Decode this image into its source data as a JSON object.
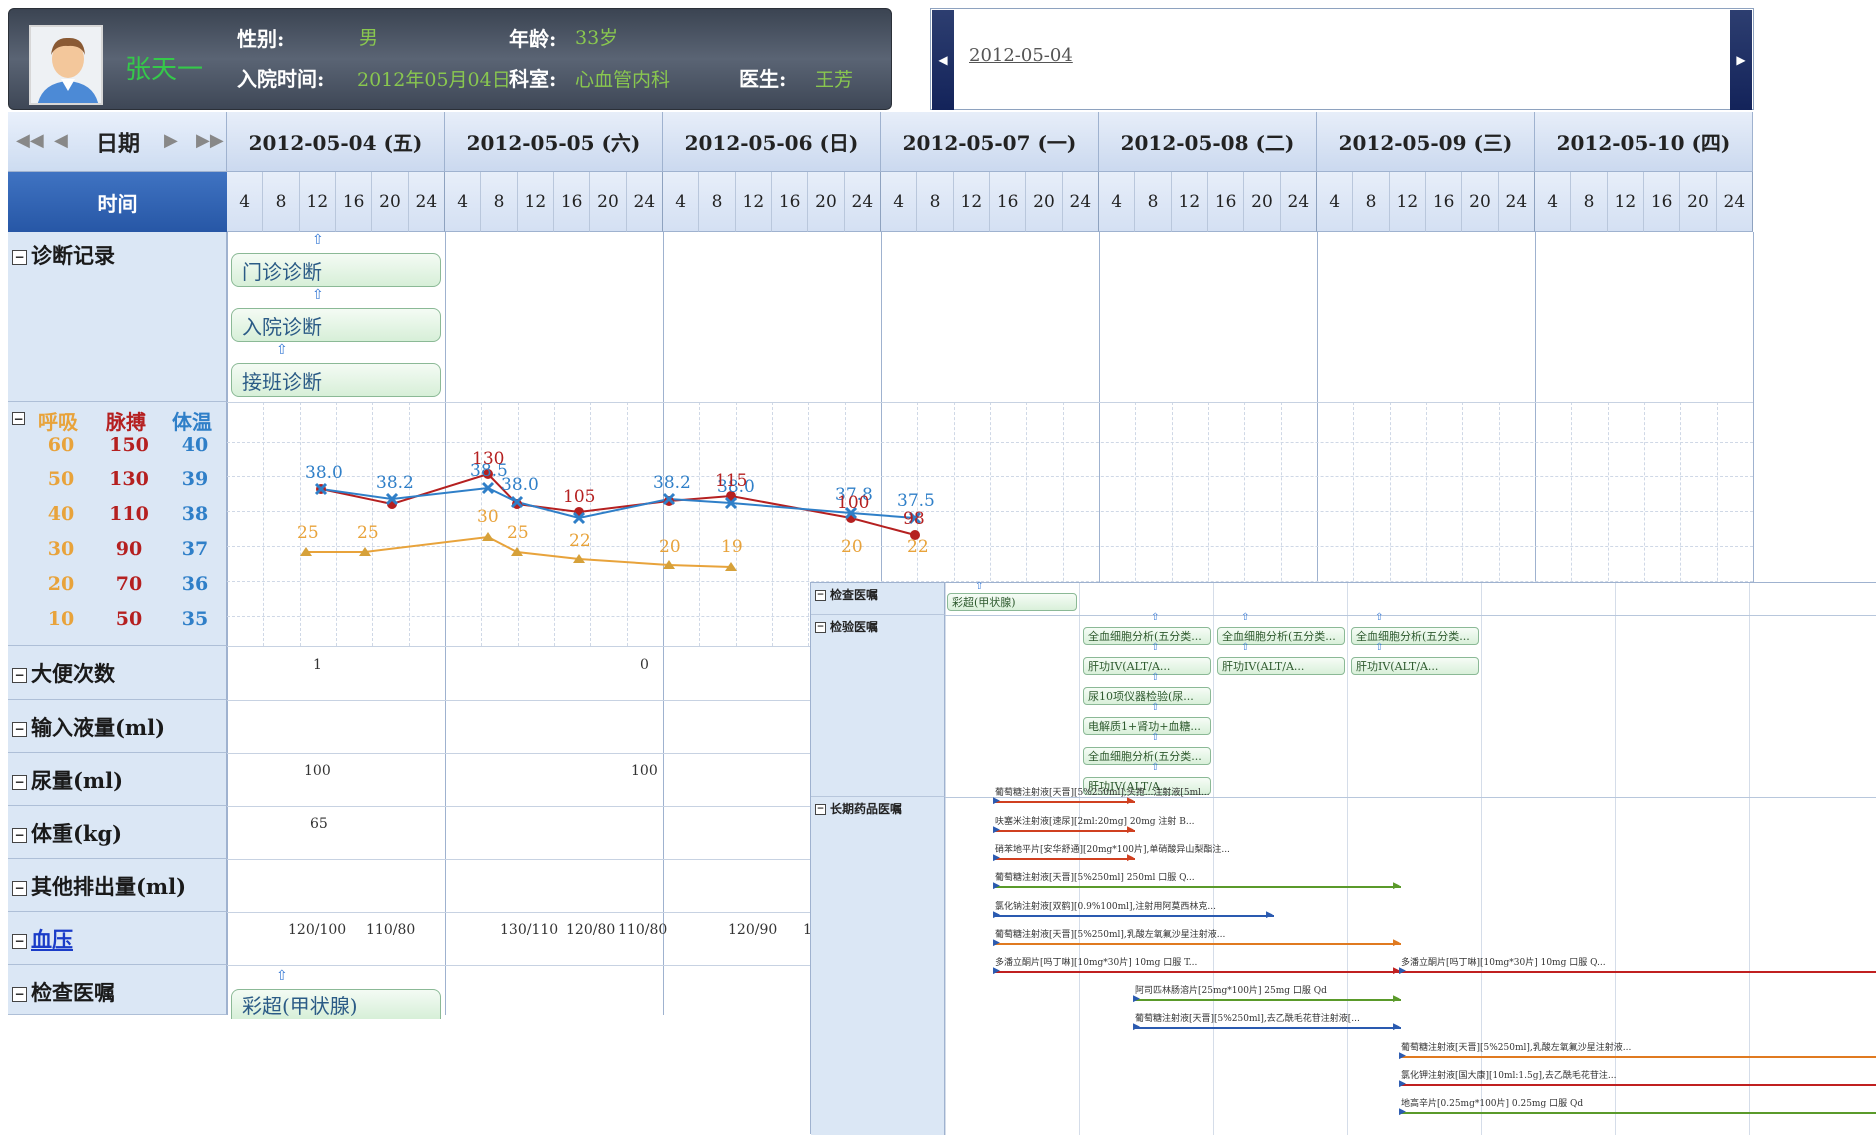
{
  "patient": {
    "name": "张天一",
    "gender_label": "性别:",
    "gender": "男",
    "age_label": "年龄:",
    "age": "33岁",
    "admit_label": "入院时间:",
    "admit_date": "2012年05月04日",
    "dept_label": "科室:",
    "dept": "心血管内科",
    "doctor_label": "医生:",
    "doctor": "王芳"
  },
  "date_nav": {
    "current_date": "2012-05-04",
    "prev_icon": "triangle-left-icon",
    "next_icon": "triangle-right-icon"
  },
  "grid_header": {
    "nav_first_icon": "double-left-arrow-icon",
    "nav_prev_icon": "left-arrow-icon",
    "nav_label": "日期",
    "nav_next_icon": "right-arrow-icon",
    "nav_last_icon": "double-right-arrow-icon",
    "time_label": "时间",
    "dates": [
      "2012-05-04 (五)",
      "2012-05-05 (六)",
      "2012-05-06 (日)",
      "2012-05-07 (一)",
      "2012-05-08 (二)",
      "2012-05-09 (三)",
      "2012-05-10 (四)"
    ],
    "hours": [
      "4",
      "8",
      "12",
      "16",
      "20",
      "24"
    ]
  },
  "rows": {
    "diagnosis_label": "诊断记录",
    "diagnosis_items": [
      "门诊诊断",
      "入院诊断",
      "接班诊断"
    ],
    "vitals_headers": {
      "resp": "呼吸",
      "pulse": "脉搏",
      "temp": "体温"
    },
    "resp_scale": [
      "60",
      "50",
      "40",
      "30",
      "20",
      "10"
    ],
    "pulse_scale": [
      "150",
      "130",
      "110",
      "90",
      "70",
      "50"
    ],
    "temp_scale": [
      "40",
      "39",
      "38",
      "37",
      "36",
      "35"
    ],
    "stool_label": "大便次数",
    "stool_values": [
      "1",
      "0"
    ],
    "input_label": "输入液量(ml)",
    "urine_label": "尿量(ml)",
    "urine_values": [
      "100",
      "100"
    ],
    "weight_label": "体重(kg)",
    "weight_values": [
      "65"
    ],
    "other_output_label": "其他排出量(ml)",
    "bp_label": "血压",
    "bp_values": [
      "120/100",
      "110/80",
      "130/110",
      "120/80",
      "110/80",
      "120/90",
      "1"
    ],
    "exam_label": "检查医嘱",
    "exam_items": [
      "彩超(甲状腺)"
    ]
  },
  "vitals": {
    "colors": {
      "resp": "#e8a33b",
      "pulse": "#b52020",
      "temp": "#2f7fc8"
    },
    "temp_labels": [
      "38.0",
      "38.2",
      "38.5",
      "38.0",
      "38.2",
      "38.0",
      "37.8",
      "37.5"
    ],
    "pulse_labels": [
      "130",
      "105",
      "115",
      "100",
      "98"
    ],
    "resp_labels": [
      "25",
      "25",
      "30",
      "25",
      "22",
      "20",
      "19",
      "20",
      "22"
    ]
  },
  "overlay": {
    "exam_label": "检查医嘱",
    "exam_items": [
      "彩超(甲状腺)"
    ],
    "lab_label": "检验医嘱",
    "lab_col1": [
      "全血细胞分析(五分类...",
      "肝功IV(ALT/A...",
      "尿10项仪器检验(尿...",
      "电解质1+肾功+血糖...",
      "全血细胞分析(五分类...",
      "肝功IV(ALT/A..."
    ],
    "lab_col2": [
      "全血细胞分析(五分类...",
      "肝功IV(ALT/A..."
    ],
    "lab_col3": [
      "全血细胞分析(五分类...",
      "肝功IV(ALT/A..."
    ],
    "longterm_label": "长期药品医嘱",
    "meds": [
      "葡萄糖注射液[天晋][5%250ml],头孢...注射液[5ml...",
      "呋塞米注射液[速尿][2ml:20mg] 20mg 注射 B...",
      "硝苯地平片[安华舒通][20mg*100片],单硝酸异山梨酯注...",
      "葡萄糖注射液[天晋][5%250ml] 250ml 口服 Q...",
      "氯化钠注射液[双鹤][0.9%100ml],注射用阿莫西林克...",
      "葡萄糖注射液[天晋][5%250ml],乳酸左氧氟沙星注射液...",
      "多潘立酮片[吗丁啉][10mg*30片] 10mg 口服 T...",
      "多潘立酮片[吗丁啉][10mg*30片] 10mg 口服 Q...",
      "阿司匹林肠溶片[25mg*100片] 25mg 口服 Qd",
      "葡萄糖注射液[天晋][5%250ml],去乙酰毛花苷注射液[...",
      "葡萄糖注射液[天晋][5%250ml],乳酸左氧氟沙星注射液...",
      "氯化钾注射液[国大康][10ml:1.5g],去乙酰毛花苷注...",
      "地高辛片[0.25mg*100片] 0.25mg 口服 Qd"
    ],
    "med_colors": [
      "#d04020",
      "#d04020",
      "#d04020",
      "#5a9a2a",
      "#2a5ab0",
      "#e07a20",
      "#c02020",
      "#c02020",
      "#5a9a2a",
      "#2a5ab0",
      "#e07a20",
      "#c02020",
      "#5a9a2a"
    ]
  }
}
